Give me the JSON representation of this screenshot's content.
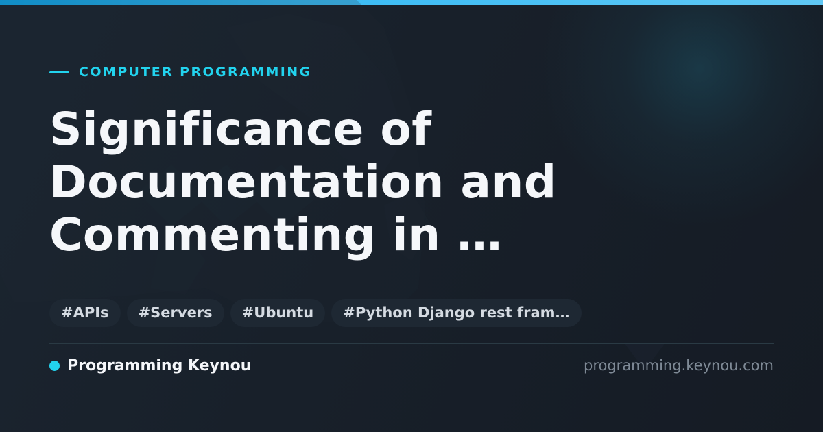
{
  "category": "COMPUTER PROGRAMMING",
  "title": "Significance of Documentation and Commenting in …",
  "tags": [
    "#APIs",
    "#Servers",
    "#Ubuntu",
    "#Python Django rest fram…"
  ],
  "brand": {
    "name": "Programming Keynou"
  },
  "site_url": "programming.keynou.com",
  "colors": {
    "accent": "#22d3ee",
    "background": "#161d26",
    "title": "#f5f7fa",
    "tag_background": "#1e2833",
    "muted_text": "#7f8a96"
  },
  "icons": {
    "category_marker": "accent-line",
    "brand_marker": "brand-dot-icon",
    "background_art": "wireframe-watermark"
  }
}
